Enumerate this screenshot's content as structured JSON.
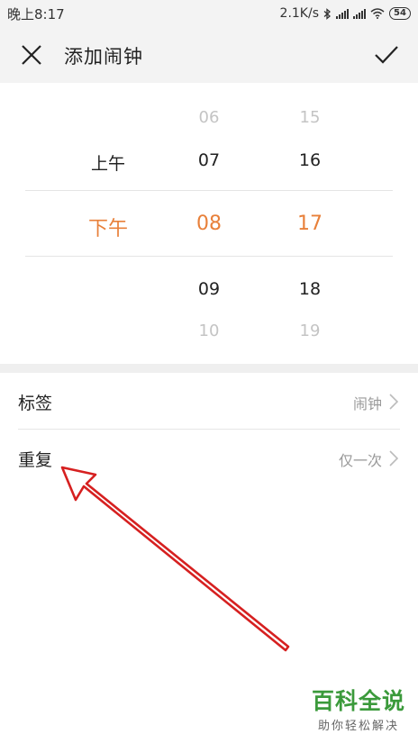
{
  "status_bar": {
    "time": "晚上8:17",
    "network_speed": "2.1K/s",
    "battery": "54",
    "icons": [
      "bluetooth-icon",
      "signal-icon",
      "signal-icon",
      "wifi-icon",
      "battery-icon"
    ]
  },
  "header": {
    "title": "添加闹钟",
    "close_icon": "close-icon",
    "confirm_icon": "check-icon"
  },
  "picker": {
    "ampm": {
      "above": "上午",
      "selected": "下午"
    },
    "hours": {
      "above2": "06",
      "above1": "07",
      "selected": "08",
      "below1": "09",
      "below2": "10"
    },
    "minutes": {
      "above2": "15",
      "above1": "16",
      "selected": "17",
      "below1": "18",
      "below2": "19"
    }
  },
  "settings": {
    "label_row": {
      "label": "标签",
      "value": "闹钟"
    },
    "repeat_row": {
      "label": "重复",
      "value": "仅一次"
    }
  },
  "watermark": {
    "title": "百科全说",
    "subtitle": "助你轻松解决"
  },
  "colors": {
    "accent": "#e8803a",
    "annotation_arrow": "#d62020",
    "watermark_green": "#3b9a3b"
  }
}
